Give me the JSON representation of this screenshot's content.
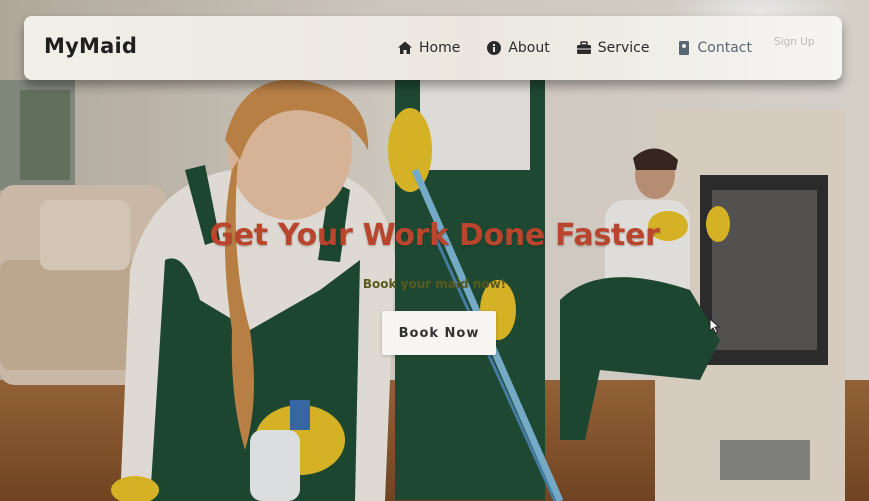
{
  "brand": "MyMaid",
  "nav": {
    "home": "Home",
    "about": "About",
    "service": "Service",
    "contact": "Contact",
    "signup": "Sign Up"
  },
  "hero": {
    "title": "Get Your Work Done Faster",
    "subtitle": "Book your maid now!",
    "button": "Book Now"
  },
  "colors": {
    "title": "#b8452c",
    "subtitle": "#5a5a1e",
    "navbar": "#efebe5",
    "uniform": "#1f4d35",
    "gloves": "#e8c02a"
  },
  "icons": {
    "home": "home-icon",
    "about": "info-icon",
    "service": "briefcase-icon",
    "contact": "contact-card-icon"
  }
}
